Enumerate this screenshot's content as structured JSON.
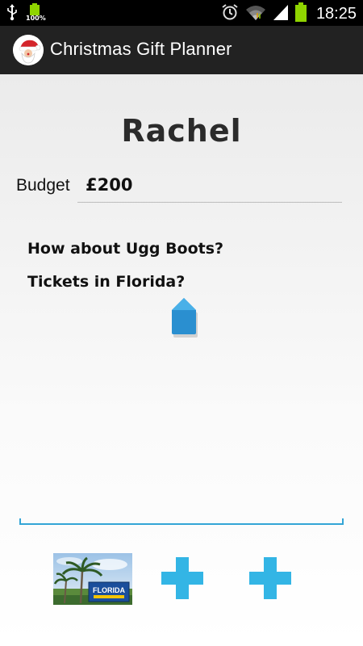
{
  "status_bar": {
    "battery_small_percent": "100%",
    "time": "18:25",
    "icons": [
      "usb-icon",
      "battery-small-icon",
      "alarm-icon",
      "wifi-icon",
      "signal-icon",
      "battery-icon"
    ]
  },
  "action_bar": {
    "title": "Christmas Gift Planner",
    "icon": "santa-icon"
  },
  "main": {
    "name": "Rachel",
    "budget_label": "Budget",
    "budget_value": "£200",
    "notes": [
      "How about Ugg Boots?",
      "Tickets in Florida?"
    ]
  },
  "attachments": {
    "items": [
      {
        "type": "photo",
        "icon": "florida-photo",
        "sign_text": "FLORIDA"
      },
      {
        "type": "add",
        "icon": "plus-icon"
      },
      {
        "type": "add",
        "icon": "plus-icon"
      }
    ]
  },
  "colors": {
    "accent": "#33b5e5",
    "status_bar": "#000000",
    "action_bar": "#222222"
  }
}
